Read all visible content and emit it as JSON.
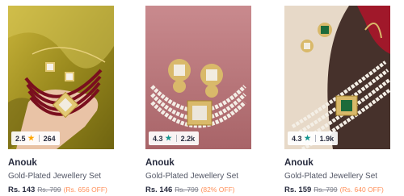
{
  "colors": {
    "star_orange": "#ffa600",
    "star_teal": "#14958f",
    "discount": "#ff905a"
  },
  "products": [
    {
      "brand": "Anouk",
      "name": "Gold-Plated Jewellery Set",
      "price": "Rs. 143",
      "mrp": "Rs. 799",
      "discount": "(Rs. 656 OFF)",
      "rating": "2.5",
      "rating_count": "264",
      "star_icon": "star-icon"
    },
    {
      "brand": "Anouk",
      "name": "Gold-Plated Jewellery Set",
      "price": "Rs. 146",
      "mrp": "Rs. 799",
      "discount": "(82% OFF)",
      "rating": "4.3",
      "rating_count": "2.2k",
      "star_icon": "star-icon"
    },
    {
      "brand": "Anouk",
      "name": "Gold-Plated Jewellery Set",
      "price": "Rs. 159",
      "mrp": "Rs. 799",
      "discount": "(Rs. 640 OFF)",
      "rating": "4.3",
      "rating_count": "1.9k",
      "star_icon": "star-icon"
    }
  ]
}
